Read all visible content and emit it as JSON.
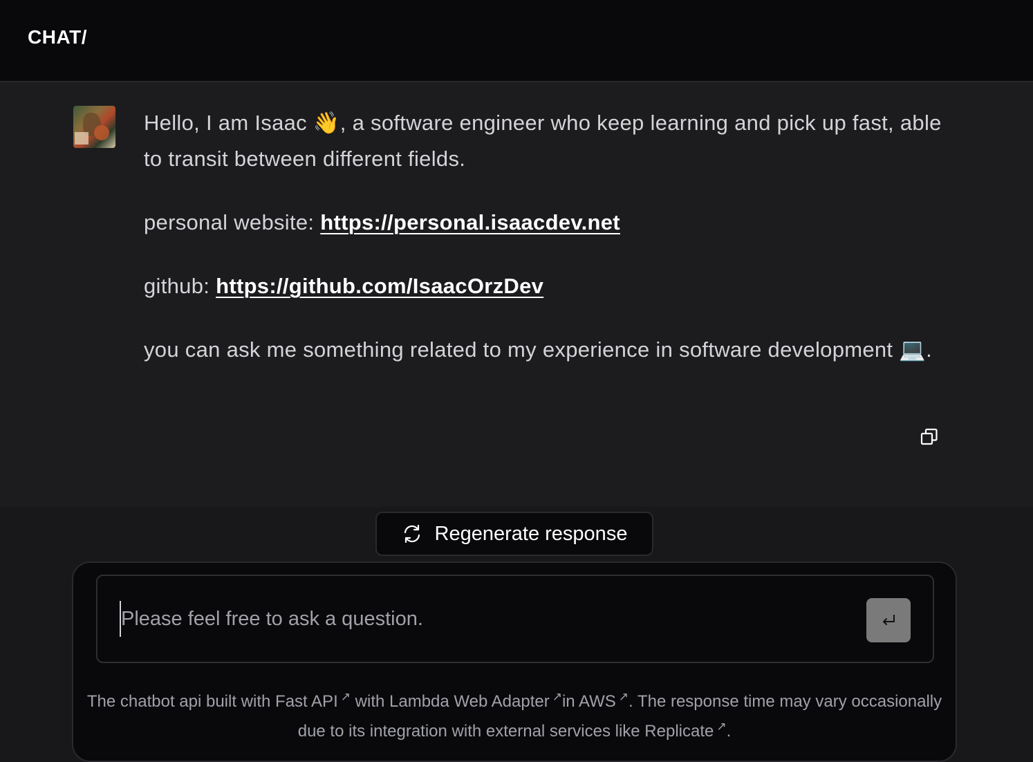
{
  "header": {
    "brand": "CHAT/"
  },
  "message": {
    "intro": "Hello, I am Isaac 👋, a software engineer who keep learning and pick up fast, able to transit between different fields.",
    "website_label": "personal website: ",
    "website_url": "https://personal.isaacdev.net",
    "github_label": "github: ",
    "github_url": "https://github.com/IsaacOrzDev",
    "closing": "you can ask me something related to my experience in software development 💻.",
    "copy_icon": "copy-icon"
  },
  "actions": {
    "regenerate_label": "Regenerate response",
    "regenerate_icon": "refresh-icon"
  },
  "composer": {
    "placeholder": "Please feel free to ask a question.",
    "value": "",
    "send_icon": "enter-return-icon"
  },
  "footer": {
    "t1": "The chatbot api built with ",
    "link_fastapi": "Fast API",
    "t2": " with ",
    "link_lambda": "Lambda Web Adapter",
    "t3": "in ",
    "link_aws": "AWS",
    "t4": ". The response time may vary occasionally due to its integration with external services like ",
    "link_replicate": "Replicate",
    "t5": ".",
    "ext_mark": "↗"
  },
  "colors": {
    "header_bg": "#09090b",
    "page_bg": "#18181b",
    "text": "#d4d4d8",
    "link": "#ffffff",
    "send_button": "#7a7a7a"
  }
}
